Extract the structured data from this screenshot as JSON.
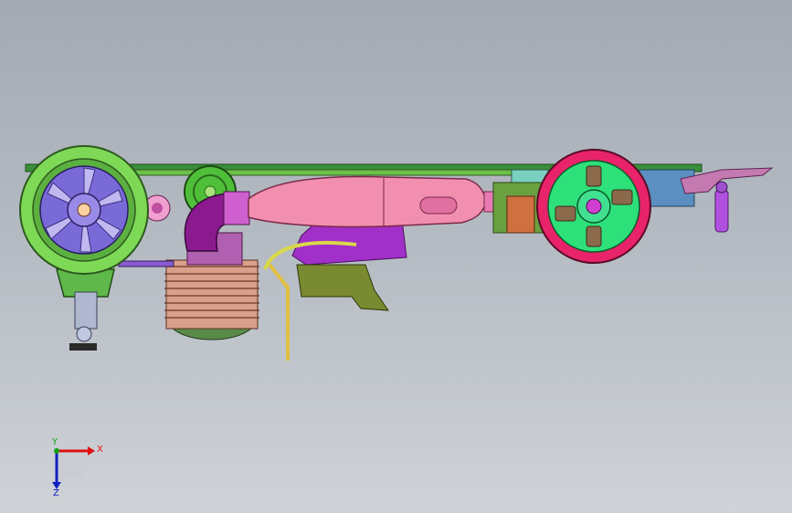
{
  "viewport": {
    "background_top": "#a3aab3",
    "background_bottom": "#cfd3d8"
  },
  "model": {
    "parts": [
      "front-wheel-green",
      "rear-wheel-red",
      "chassis-plate",
      "exhaust-pipe-pink",
      "exhaust-header-purple",
      "engine-cylinder-copper",
      "fuel-tank-purple",
      "fuel-line-yellow",
      "front-suspension-green",
      "rear-wing-mount-pink",
      "spur-gear-green",
      "steering-servo-purple"
    ],
    "colors": {
      "front_wheel": "#7ed957",
      "rear_wheel": "#e8236a",
      "exhaust": "#f28fb0",
      "header": "#8b1a8f",
      "engine": "#d9a08a",
      "tank": "#a030c8",
      "chassis": "#22b24c",
      "fuel_line": "#d8d84a"
    }
  },
  "triad": {
    "x_label": "X",
    "y_label": "Y",
    "z_label": "Z",
    "x_color": "#e01010",
    "y_color": "#10a010",
    "z_color": "#1020c0"
  }
}
